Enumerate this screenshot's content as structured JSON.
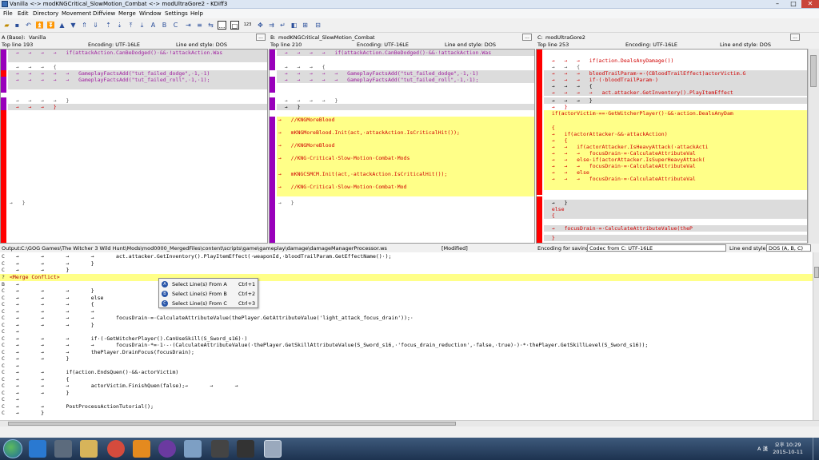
{
  "window": {
    "title": "Vanilla <-> modKNGCritical_SlowMotion_Combat <-> modUltraGore2 - KDiff3",
    "minimize": "–",
    "maximize": "□",
    "close": "✕"
  },
  "menu": [
    "File",
    "Edit",
    "Directory",
    "Movement",
    "Diffview",
    "Merge",
    "Window",
    "Settings",
    "Help"
  ],
  "toolbar": {
    "zoom": "123"
  },
  "paneA": {
    "label": "A (Base):",
    "file": "Vanilla",
    "encoding": "Encoding: UTF-16LE",
    "lineend": "Line end style: DOS",
    "topline": "Top line 193"
  },
  "paneB": {
    "label": "B:",
    "file": "modKNGCritical_SlowMotion_Combat",
    "encoding": "Encoding: UTF-16LE",
    "lineend": "Line end style: DOS",
    "topline": "Top line 210"
  },
  "paneC": {
    "label": "C:",
    "file": "modUltraGore2",
    "encoding": "Encoding: UTF-16LE",
    "lineend": "Line end style: DOS",
    "topline": "Top line 253"
  },
  "browse": "...",
  "codeA": [
    "  →   →   →   →   if(attackAction.CanBeDodged()·&&·!attackAction.Was",
    "",
    "  →   →   →   {",
    "  →   →   →   →   →   GameplayFactsAdd(\"tut_failed_dodge\",·1,·1)",
    "  →   →   →   →   →   GameplayFactsAdd(\"tut_failed_roll\",·1,·1);",
    "",
    "",
    "  →   →   →   →   }",
    "  →   →   →   }",
    "→   }"
  ],
  "codeB": [
    "  →   →   →   →   if(attackAction.CanBeDodged()·&&·!attackAction.Was",
    "  →   →   →   {",
    "  →   →   →   →   →   GameplayFactsAdd(\"tut_failed_dodge\",·1,·1)",
    "  →   →   →   →   →   GameplayFactsAdd(\"tut_failed_roll\",·1,·1);",
    "  →   →   →   →   }",
    "  →   }",
    "→   //KNGMoreBlood",
    "→   mKNGMoreBlood.Init(act,·attackAction.IsCriticalHit());",
    "→   //KNGMoreBlood",
    "→   //KNG·Critical·Slow·Motion·Combat·Mods",
    "→   mKNGCSMCM.Init(act,·attackAction.IsCriticalHit());",
    "→   //KNG·Critical·Slow·Motion·Combat·Mod",
    "→   }"
  ],
  "codeC": [
    "  →   →   →   if(action.DealsAnyDamage())",
    "  →   →   {",
    "  →   →   →   bloodTrailParam·=·(CBloodTrailEffect)actorVictim.G",
    "  →   →   →   if·(·bloodTrailParam·)",
    "  →   →   →   {",
    "  →   →   →   →   act.attacker.GetInventory().PlayItemEffect",
    "  →   →   →   }",
    "  →   }",
    "  if(actorVictim·==·GetWitcherPlayer()·&&·action.DealsAnyDam",
    "  {",
    "  →   if(actorAttacker·&&·attackAction)",
    "  →   {",
    "  →   →   if(actorAttacker.IsHeavyAttack(·attackActi",
    "  →   →   →   focusDrain·=·CalculateAttributeVal",
    "  →   →   else·if(actorAttacker.IsSuperHeavyAttack(",
    "  →   →   →   focusDrain·=·CalculateAttributeVal",
    "  →   →   else",
    "  →   →   →   focusDrain·=·CalculateAttributeVal",
    "  →   }",
    "  else",
    "  {",
    "  →   focusDrain·=·CalculateAttributeValue(theP",
    "  }"
  ],
  "output": {
    "label": "Output:",
    "path": "C:\\GOG Games\\The Witcher 3 Wild Hunt\\Mods\\mod0000_MergedFiles\\content\\scripts\\game\\gameplay\\damage\\damageManagerProcessor.ws",
    "status": "[Modified]",
    "enc_label": "Encoding for saving:",
    "enc_value": "Codec from C: UTF-16LE",
    "le_label": "Line end style:",
    "le_value": "DOS (A, B, C)",
    "lines": [
      {
        "g": "C",
        "t": "  →       →       →       →       act.attacker.GetInventory().PlayItemEffect(·weaponId,·bloodTrailParam.GetEffectName()·);"
      },
      {
        "g": "C",
        "t": "  →       →       →       }"
      },
      {
        "g": "C",
        "t": "  →       →       }"
      },
      {
        "g": "?",
        "t": "<Merge Conflict>"
      },
      {
        "g": "B",
        "t": "  →"
      },
      {
        "g": "C",
        "t": "  →       →       →       }"
      },
      {
        "g": "C",
        "t": "  →       →       →       else"
      },
      {
        "g": "C",
        "t": "  →       →       →       {"
      },
      {
        "g": "C",
        "t": "  →       →       →       →"
      },
      {
        "g": "C",
        "t": "  →       →       →       →       focusDrain·=·CalculateAttributeValue(thePlayer.GetAttributeValue('light_attack_focus_drain'));·"
      },
      {
        "g": "C",
        "t": "  →       →       →       }"
      },
      {
        "g": "C",
        "t": "  →"
      },
      {
        "g": "C",
        "t": "  →       →       →       if·(·GetWitcherPlayer().CanUseSkill(S_Sword_s16)·)"
      },
      {
        "g": "C",
        "t": "  →       →       →       →       focusDrain·*=·1·-·(CalculateAttributeValue(·thePlayer.GetSkillAttributeValue(S_Sword_s16,·'focus_drain_reduction',·false,·true)·)·*·thePlayer.GetSkillLevel(S_Sword_s16));"
      },
      {
        "g": "C",
        "t": "  →       →       →       thePlayer.DrainFocus(focusDrain);"
      },
      {
        "g": "C",
        "t": "  →       →       }"
      },
      {
        "g": "C",
        "t": "  →"
      },
      {
        "g": "C",
        "t": "  →       →       if(action.EndsQuen()·&&·actorVictim)"
      },
      {
        "g": "C",
        "t": "  →       →       {"
      },
      {
        "g": "C",
        "t": "  →       →       →       actorVictim.FinishQuen(false);→       →       →"
      },
      {
        "g": "C",
        "t": "  →       →       }"
      },
      {
        "g": "C",
        "t": "  →"
      },
      {
        "g": "C",
        "t": "  →       →       PostProcessActionTutorial();"
      },
      {
        "g": "C",
        "t": "  →       }"
      }
    ]
  },
  "context_menu": [
    {
      "key": "A",
      "label": "Select Line(s) From A",
      "shortcut": "Ctrl+1"
    },
    {
      "key": "B",
      "label": "Select Line(s) From B",
      "shortcut": "Ctrl+2"
    },
    {
      "key": "C",
      "label": "Select Line(s) From C",
      "shortcut": "Ctrl+3"
    }
  ],
  "taskbar": {
    "ime": "A 漢",
    "time_ampm": "오후 10:29",
    "date": "2015-10-11"
  },
  "colors": {
    "removed": "#ff0000",
    "conflict": "#9900bb",
    "added": "#ffff88",
    "unchanged": "#dcdcdc"
  }
}
